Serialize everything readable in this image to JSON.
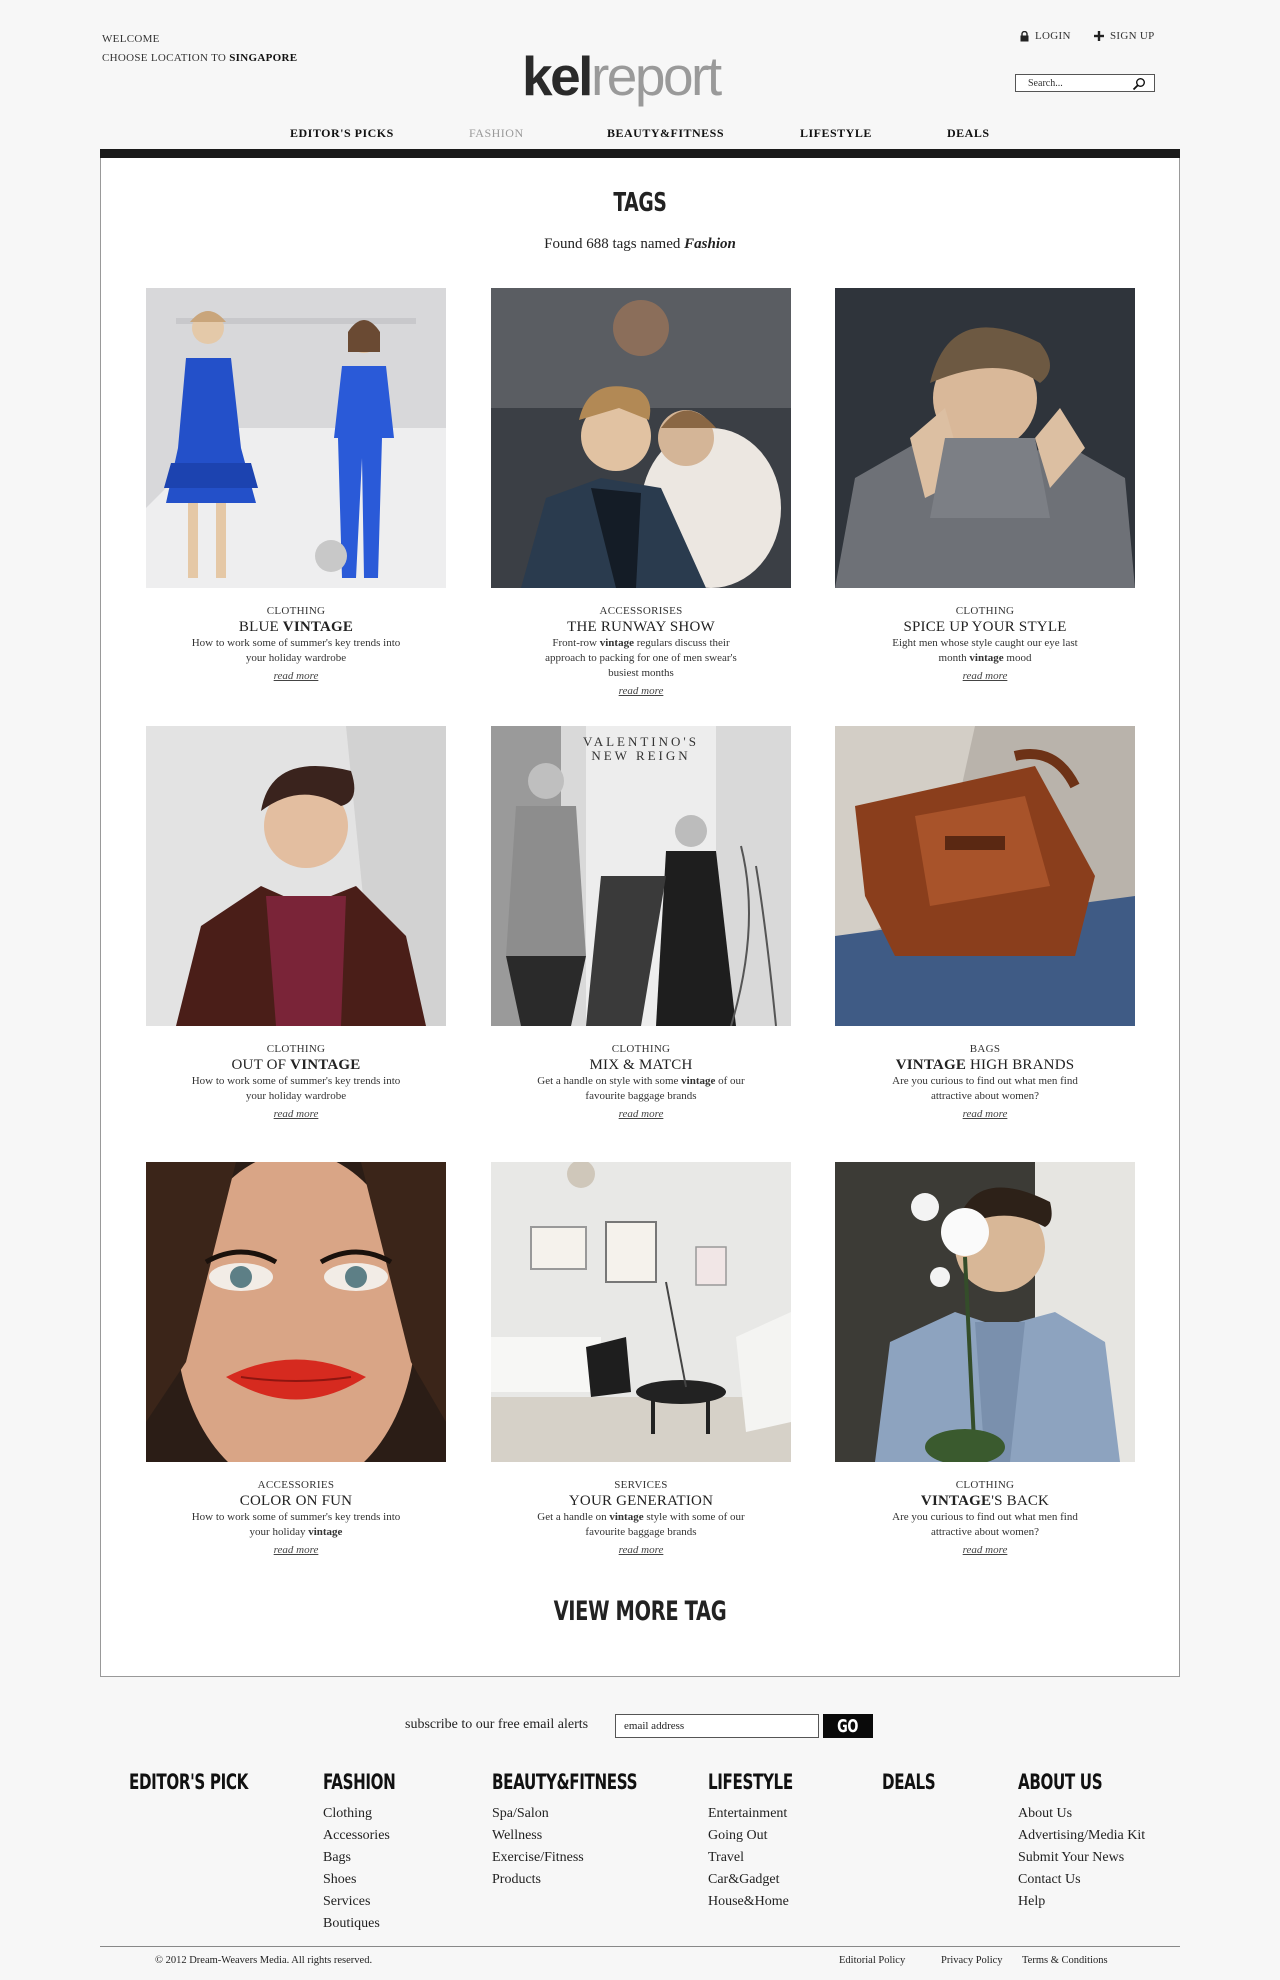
{
  "header": {
    "welcome": "WELCOME",
    "location_prefix": "CHOOSE LOCATION TO",
    "location": "SINGAPORE",
    "logo_part1": "kel",
    "logo_part2": "report",
    "login": "LOGIN",
    "signup": "SIGN UP",
    "search_placeholder": "Search..."
  },
  "nav": [
    {
      "label": "EDITOR'S PICKS",
      "active": false
    },
    {
      "label": "FASHION",
      "active": true
    },
    {
      "label": "BEAUTY&FITNESS",
      "active": false
    },
    {
      "label": "LIFESTYLE",
      "active": false
    },
    {
      "label": "DEALS",
      "active": false
    }
  ],
  "main": {
    "title": "TAGS",
    "found_prefix": "Found 688 tags named",
    "found_term": "Fashion",
    "view_more": "VIEW MORE TAG"
  },
  "cards": [
    {
      "category": "CLOTHING",
      "title_a": "BLUE ",
      "title_b": "VINTAGE",
      "title_c": "",
      "desc_a": "How to work some of summer's key trends into your holiday wardrobe",
      "desc_b": "",
      "desc_c": "",
      "more": "read more"
    },
    {
      "category": "ACCESSORISES",
      "title_a": "THE RUNWAY SHOW",
      "title_b": "",
      "title_c": "",
      "desc_a": "Front-row ",
      "desc_b": "vintage",
      "desc_c": " regulars discuss their approach to packing for one of men swear's busiest months",
      "more": "read more"
    },
    {
      "category": "CLOTHING",
      "title_a": "SPICE UP YOUR STYLE",
      "title_b": "",
      "title_c": "",
      "desc_a": "Eight men whose style caught our eye last month ",
      "desc_b": "vintage",
      "desc_c": " mood",
      "more": "read more"
    },
    {
      "category": "CLOTHING",
      "title_a": "OUT OF ",
      "title_b": "VINTAGE",
      "title_c": "",
      "desc_a": "How to work some of summer's key trends into your holiday wardrobe",
      "desc_b": "",
      "desc_c": "",
      "more": "read more"
    },
    {
      "category": "CLOTHING",
      "title_a": "MIX & MATCH",
      "title_b": "",
      "title_c": "",
      "desc_a": "Get a handle on style with some ",
      "desc_b": "vintage",
      "desc_c": " of our favourite baggage brands",
      "more": "read more"
    },
    {
      "category": "BAGS",
      "title_a": "",
      "title_b": "VINTAGE",
      "title_c": " HIGH BRANDS",
      "desc_a": "Are you curious to find out what men find attractive about women?",
      "desc_b": "",
      "desc_c": "",
      "more": "read more"
    },
    {
      "category": "ACCESSORIES",
      "title_a": "COLOR ON FUN",
      "title_b": "",
      "title_c": "",
      "desc_a": "How to work some of summer's key trends into your holiday ",
      "desc_b": "vintage",
      "desc_c": "",
      "more": "read more"
    },
    {
      "category": "SERVICES",
      "title_a": "YOUR GENERATION",
      "title_b": "",
      "title_c": "",
      "desc_a": "Get a handle on ",
      "desc_b": "vintage",
      "desc_c": " style with some of our favourite baggage brands",
      "more": "read more"
    },
    {
      "category": "CLOTHING",
      "title_a": "",
      "title_b": "VINTAGE",
      "title_c": "'S BACK",
      "desc_a": "Are you curious to find out what men find attractive about women?",
      "desc_b": "",
      "desc_c": "",
      "more": "read more"
    }
  ],
  "subscribe": {
    "label": "subscribe to our free email alerts",
    "placeholder": "email address",
    "button": "GO"
  },
  "footer": {
    "columns": [
      {
        "heading": "EDITOR'S PICK",
        "links": []
      },
      {
        "heading": "FASHION",
        "links": [
          "Clothing",
          "Accessories",
          "Bags",
          "Shoes",
          "Services",
          "Boutiques"
        ]
      },
      {
        "heading": "BEAUTY&FITNESS",
        "links": [
          "Spa/Salon",
          "Wellness",
          "Exercise/Fitness",
          "Products"
        ]
      },
      {
        "heading": "LIFESTYLE",
        "links": [
          "Entertainment",
          "Going Out",
          "Travel",
          "Car&Gadget",
          "House&Home"
        ]
      },
      {
        "heading": "DEALS",
        "links": []
      },
      {
        "heading": "ABOUT US",
        "links": [
          "About Us",
          "Advertising/Media Kit",
          "Submit Your News",
          "Contact Us",
          "Help"
        ]
      }
    ],
    "copyright": "© 2012 Dream-Weavers Media. All rights reserved.",
    "editorial": "Editorial Policy",
    "privacy": "Privacy Policy",
    "terms": "Terms & Conditions"
  },
  "colors": {
    "topbar": "#1a1a1a",
    "active_nav": "#999999",
    "go_button": "#0a0a0a"
  }
}
